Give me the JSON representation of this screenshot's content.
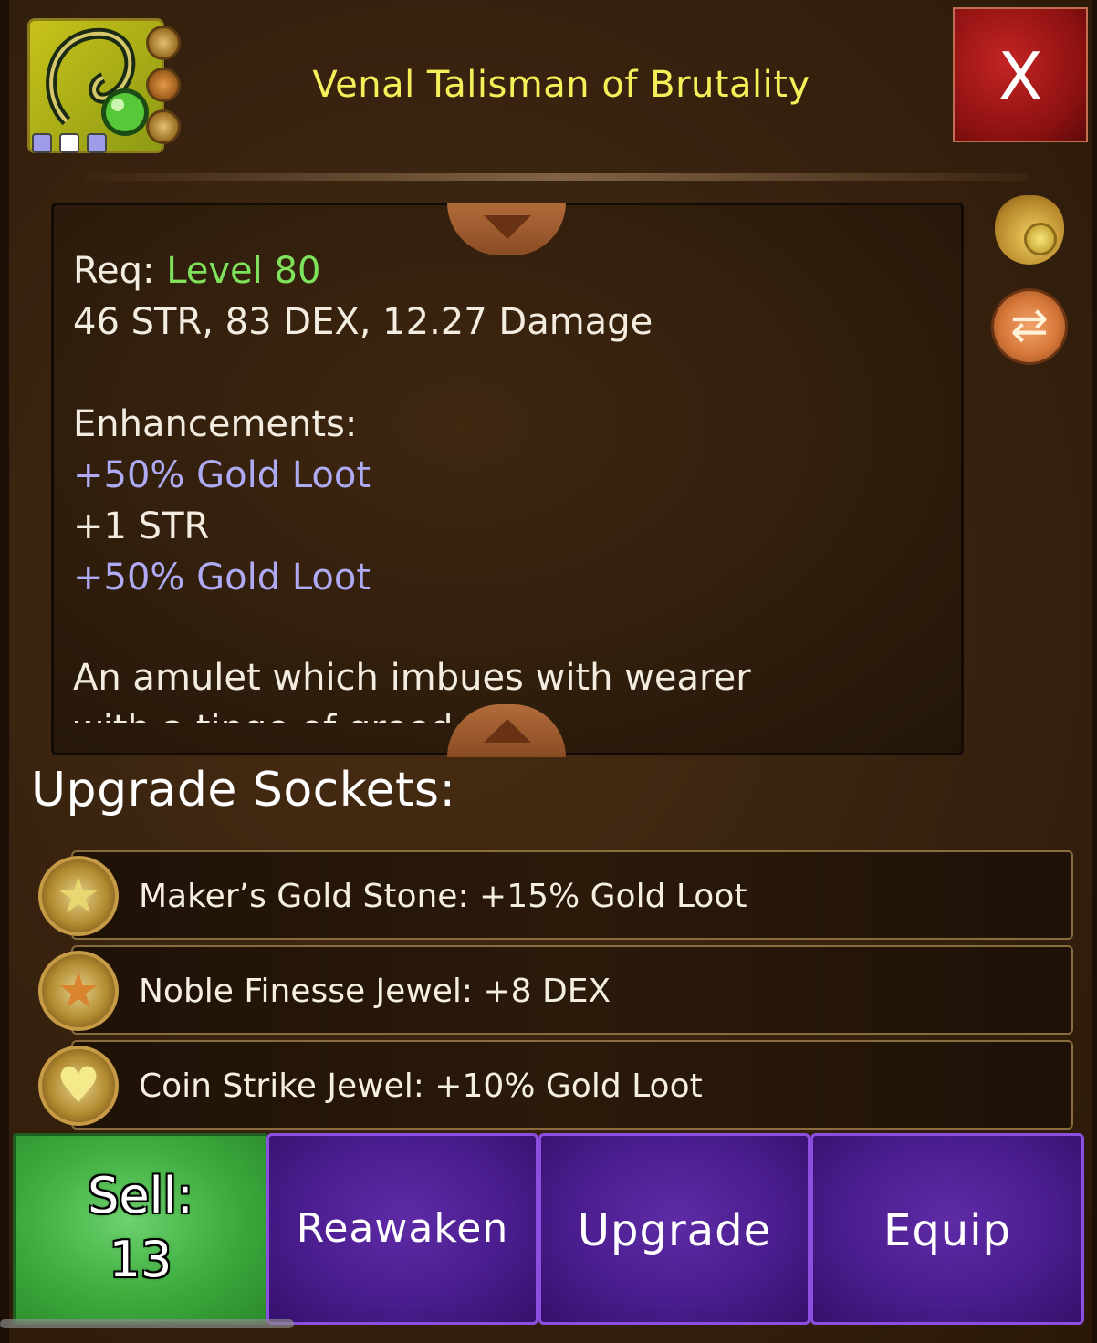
{
  "header": {
    "title": "Venal Talisman of Brutality",
    "close_label": "X",
    "item_icon": "amulet-icon",
    "socket_badges": [
      "star-gem-icon",
      "star-gem-icon",
      "heart-gem-icon"
    ],
    "upgrade_slots": 3
  },
  "details": {
    "req_prefix": "Req: ",
    "req_level": "Level 80",
    "stats": "46 STR, 83 DEX, 12.27 Damage",
    "enhancements_heading": "Enhancements:",
    "enhancements": [
      "+50% Gold Loot",
      "+1 STR",
      "+50% Gold Loot"
    ],
    "description": "An amulet which imbues with wearer",
    "description_cut": "with a tinge of greed"
  },
  "side_icons": [
    "gold-bag-icon",
    "swap-icon"
  ],
  "sockets": {
    "title": "Upgrade Sockets:",
    "items": [
      {
        "icon": "gold-star-gem-icon",
        "text": "Maker’s Gold Stone: +15% Gold Loot"
      },
      {
        "icon": "bronze-star-gem-icon",
        "text": "Noble Finesse Jewel: +8 DEX"
      },
      {
        "icon": "heart-gem-icon",
        "text": "Coin Strike Jewel: +10% Gold Loot"
      }
    ]
  },
  "actions": {
    "sell_label": "Sell:",
    "sell_value": "13",
    "reawaken": "Reawaken",
    "upgrade": "Upgrade",
    "equip": "Equip"
  },
  "colors": {
    "title": "#f5f05a",
    "level": "#7ee25a",
    "gold_loot": "#aeaaf4",
    "sell_green": "#3fae3f",
    "action_purple": "#4a1d8e",
    "close_red": "#8a1010"
  }
}
